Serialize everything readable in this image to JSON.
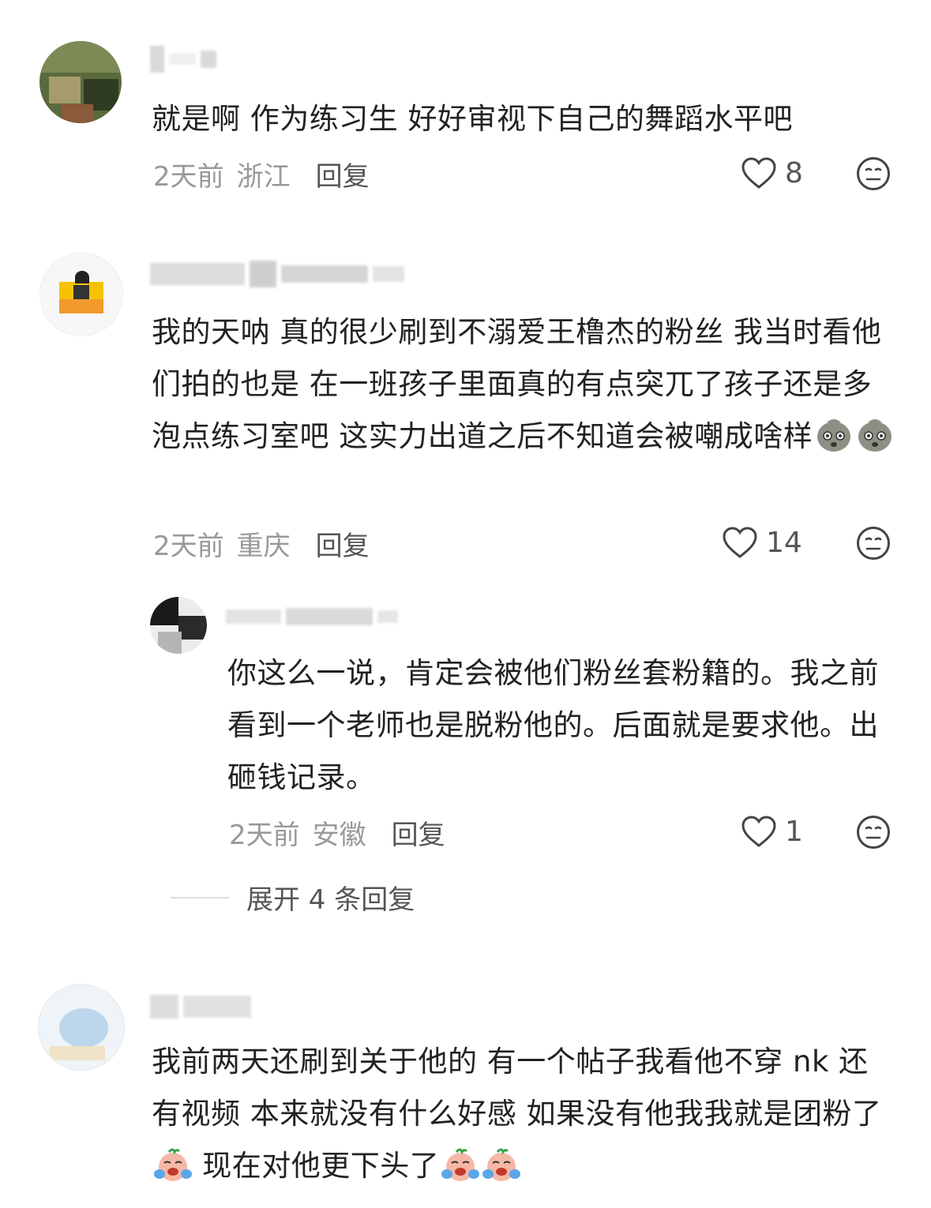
{
  "comments": [
    {
      "text": "就是啊 作为练习生 好好审视下自己的舞蹈水平吧",
      "time": "2天前",
      "location": "浙江",
      "reply_label": "回复",
      "likes": "8"
    },
    {
      "text": "我的天呐  真的很少刷到不溺爱王橹杰的粉丝  我当时看他们拍的也是  在一班孩子里面真的有点突兀了孩子还是多泡点练习室吧  这实力出道之后不知道会被嘲成啥样",
      "time": "2天前",
      "location": "重庆",
      "reply_label": "回复",
      "likes": "14",
      "reply": {
        "text": "你这么一说，肯定会被他们粉丝套粉籍的。我之前看到一个老师也是脱粉他的。后面就是要求他。出砸钱记录。",
        "time": "2天前",
        "location": "安徽",
        "reply_label": "回复",
        "likes": "1"
      },
      "expand_label": "展开 4 条回复"
    },
    {
      "text_part1": "我前两天还刷到关于他的 有一个帖子我看他不穿 nk 还有视频 本来就没有什么好感 如果没有他我我就是团粉了",
      "text_part2": " 现在对他更下头了"
    }
  ],
  "icons": {
    "like": "heart-outline-icon",
    "dislike": "neutral-face-icon",
    "emoji_cry": "crying-face-emoji",
    "emoji_potato": "potato-face-emoji"
  },
  "colors": {
    "text": "#222222",
    "meta": "#999999",
    "reply": "#555555",
    "divider": "#dddddd"
  }
}
